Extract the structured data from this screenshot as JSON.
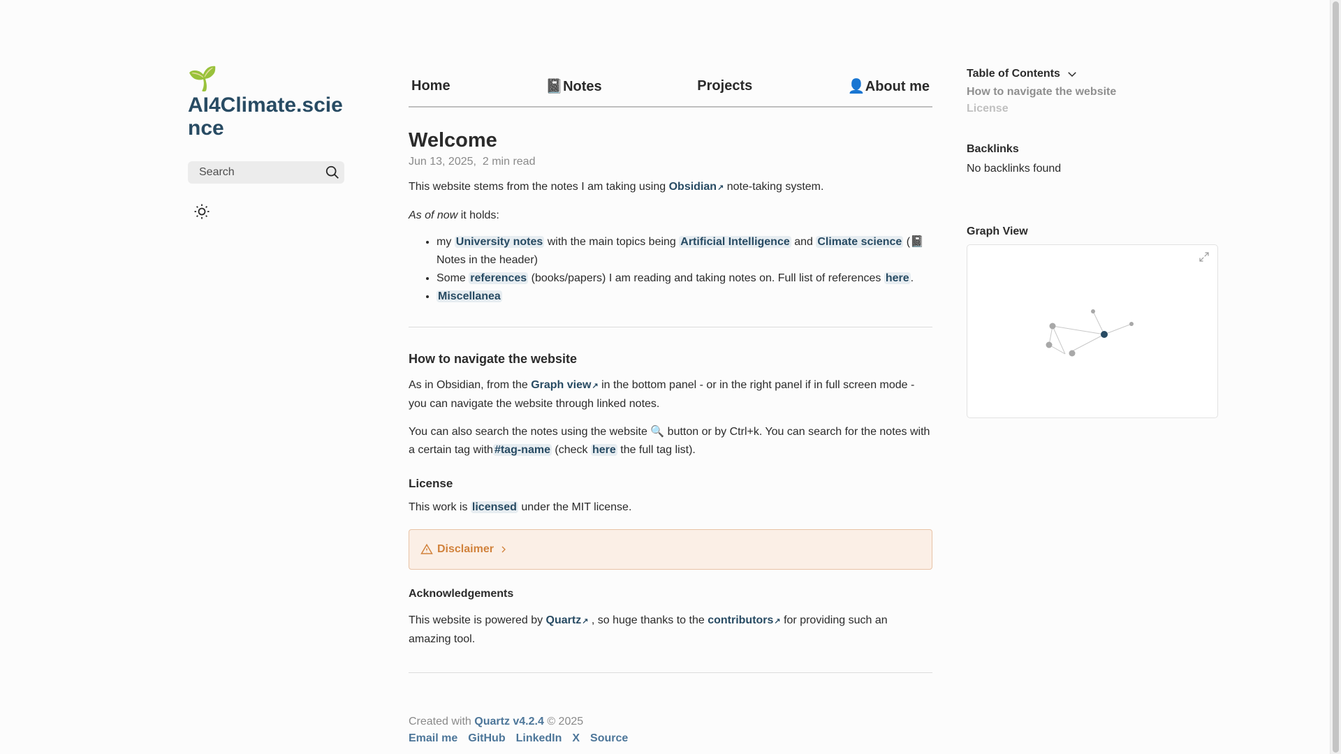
{
  "site": {
    "logo_emoji": "🌱",
    "title": "AI4Climate.science"
  },
  "search": {
    "placeholder": "Search"
  },
  "nav": {
    "home": "Home",
    "notes": "📓Notes",
    "projects": "Projects",
    "about": "👤About me"
  },
  "article": {
    "title": "Welcome",
    "date": "Jun 13, 2025",
    "read_time": "2 min read",
    "intro_pre": "This website stems from the notes I am taking using ",
    "obsidian_link": "Obsidian",
    "intro_post": " note-taking system.",
    "as_of_now_em": "As of now",
    "as_of_now_post": " it holds:",
    "list": {
      "item1_pre": "my ",
      "item1_link1": "University notes",
      "item1_mid1": " with the main topics being ",
      "item1_link2": "Artificial Intelligence",
      "item1_mid2": " and ",
      "item1_link3": "Climate science",
      "item1_post": " (📓 Notes in the header)",
      "item2_pre": "Some ",
      "item2_link1": "references",
      "item2_mid": " (books/papers) I am reading and taking notes on. Full list of references ",
      "item2_link2": "here",
      "item2_post": ".",
      "item3_link": "Miscellanea"
    },
    "nav_heading": "How to navigate the website",
    "nav_p1_pre": "As in Obsidian, from the ",
    "nav_p1_link": "Graph view",
    "nav_p1_post": " in the bottom panel - or in the right panel if in full screen mode - you can navigate the website through linked notes.",
    "nav_p2_pre": "You can also search the notes using the website 🔍 button or by Ctrl+k. You can search for the notes with a certain tag with",
    "nav_p2_tag": "#tag-name",
    "nav_p2_mid": " (check ",
    "nav_p2_link": "here",
    "nav_p2_post": " the full tag list).",
    "license_heading": "License",
    "license_pre": "This work is ",
    "license_link": "licensed",
    "license_post": " under the MIT license.",
    "callout_label": "Disclaimer",
    "ack_heading": "Acknowledgements",
    "ack_pre": "This website is powered by ",
    "ack_link1": "Quartz",
    "ack_mid": " , so huge thanks to the ",
    "ack_link2": "contributors",
    "ack_post": " for providing such an amazing tool."
  },
  "footer": {
    "created_pre": "Created with ",
    "quartz_link": "Quartz v4.2.4",
    "copyright": " © 2025",
    "links": [
      "Email me",
      "GitHub",
      "LinkedIn",
      "X",
      "Source"
    ]
  },
  "toc": {
    "title": "Table of Contents",
    "items": [
      "How to navigate the website",
      "License"
    ]
  },
  "backlinks": {
    "title": "Backlinks",
    "empty_text": "No backlinks found"
  },
  "graph": {
    "title": "Graph View"
  },
  "colors": {
    "accent": "#284b63",
    "callout": "#d1823c",
    "muted": "#8a8a8a"
  },
  "icons": {
    "search": "search-icon",
    "theme": "sun-icon",
    "toc_toggle": "chevron-down-icon",
    "external": "external-link-icon",
    "warning": "warning-triangle-icon",
    "expand": "expand-graph-icon"
  }
}
